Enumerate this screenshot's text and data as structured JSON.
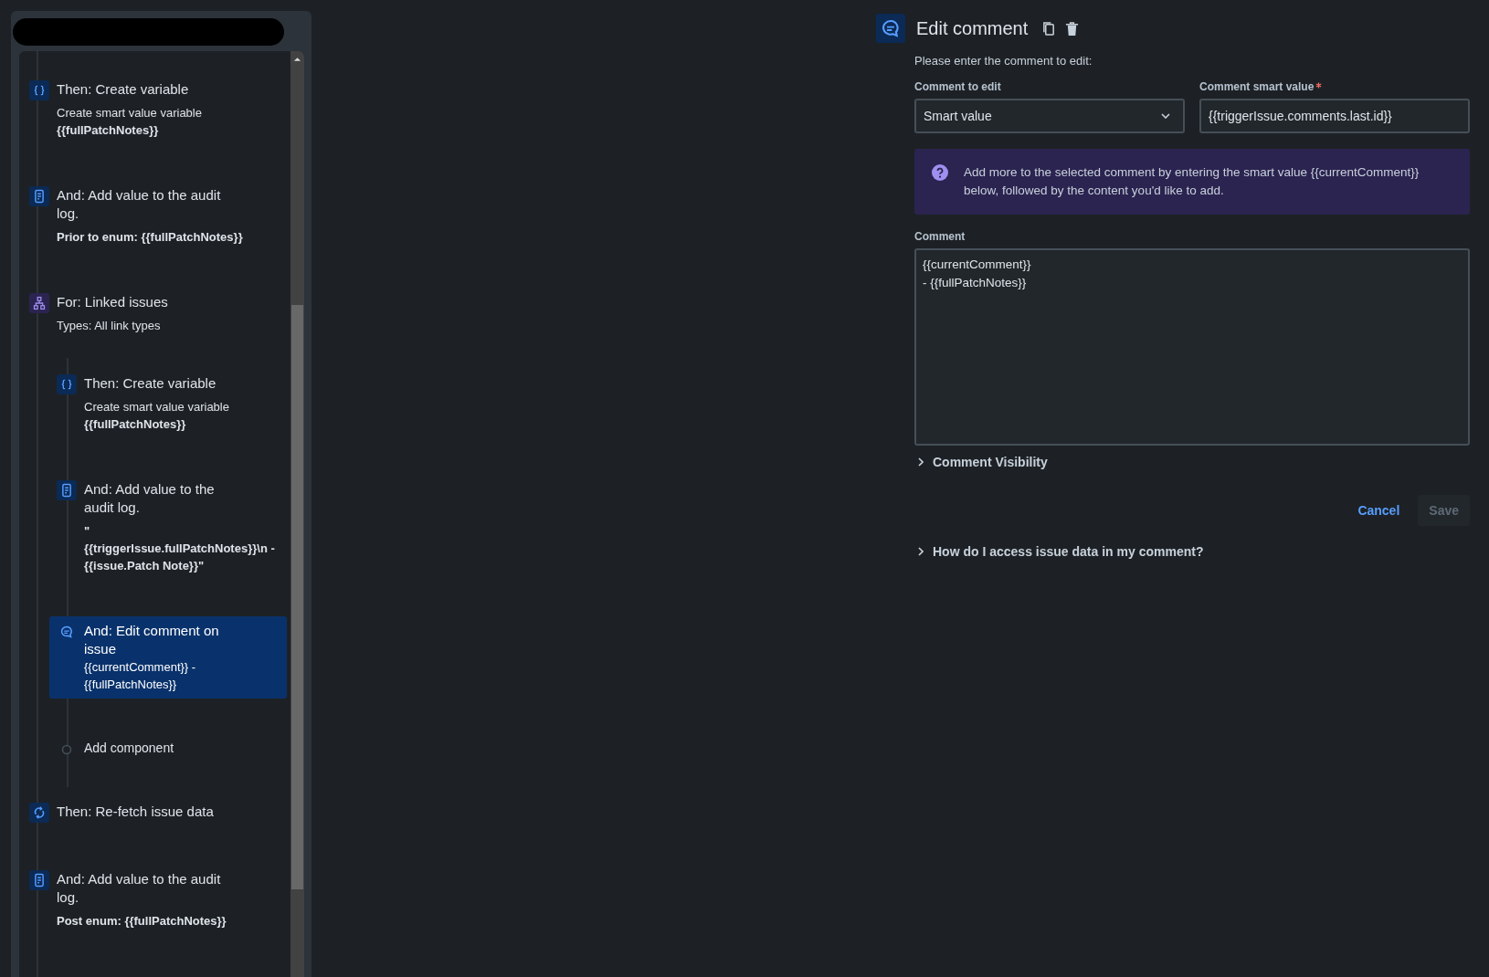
{
  "rule_panel": {
    "components": [
      {
        "kind": "variable",
        "title": "Then: Create variable",
        "detail": "Create smart value variable **{{fullPatchNotes}}**",
        "selected": false
      },
      {
        "kind": "log",
        "title": "And: Add value to the audit log.",
        "detail": "**Prior to enum: {{fullPatchNotes}}**",
        "selected": false
      },
      {
        "kind": "branch",
        "title": "For: Linked issues",
        "detail": "Types: All link types",
        "selected": false,
        "children": [
          {
            "kind": "variable",
            "title": "Then: Create variable",
            "detail": "Create smart value variable **{{fullPatchNotes}}**",
            "selected": false
          },
          {
            "kind": "log",
            "title": "And: Add value to the audit log.",
            "detail": "**\" {{triggerIssue.fullPatchNotes}}\\n - {{issue.Patch Note}}\"**",
            "selected": false
          },
          {
            "kind": "comment",
            "title": "And: Edit comment on issue",
            "detail": "{{currentComment}} - {{fullPatchNotes}}",
            "selected": true
          },
          {
            "kind": "add",
            "title": "Add component"
          }
        ]
      },
      {
        "kind": "refetch",
        "title": "Then: Re-fetch issue data",
        "selected": false
      },
      {
        "kind": "log",
        "title": "And: Add value to the audit log.",
        "detail": "**Post enum: {{fullPatchNotes}}**",
        "selected": false
      }
    ]
  },
  "editor": {
    "title": "Edit comment",
    "intro": "Please enter the comment to edit:",
    "comment_to_edit": {
      "label": "Comment to edit",
      "value": "Smart value"
    },
    "smart_value": {
      "label": "Comment smart value",
      "required": true,
      "value": "{{triggerIssue.comments.last.id}}"
    },
    "info": "Add more to the selected comment by entering the smart value {{currentComment}} below, followed by the content you'd like to add.",
    "comment": {
      "label": "Comment",
      "value": "{{currentComment}}\n- {{fullPatchNotes}}"
    },
    "visibility": {
      "label": "Comment Visibility",
      "expanded": false
    },
    "buttons": [
      {
        "kind": "link",
        "label": "Cancel"
      },
      {
        "kind": "primary",
        "label": "Save",
        "disabled": true
      }
    ],
    "help": {
      "label": "How do I access issue data in my comment?",
      "expanded": false
    }
  }
}
